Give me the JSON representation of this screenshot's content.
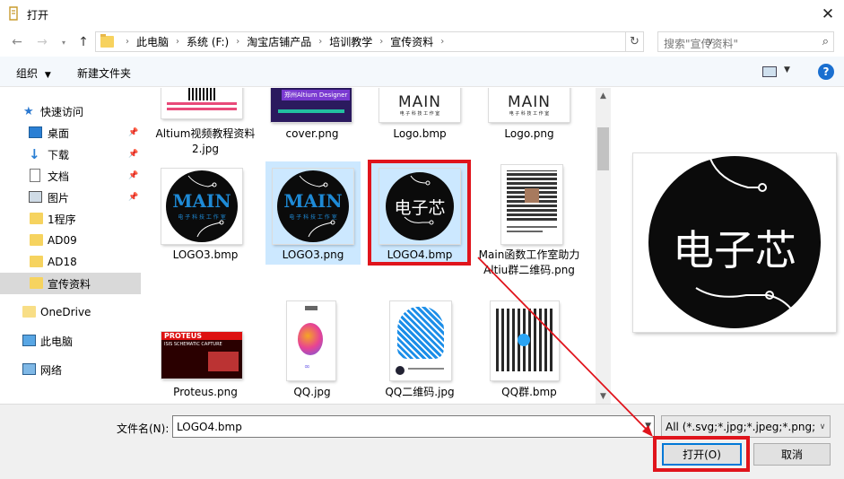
{
  "window": {
    "title": "打开"
  },
  "nav": {
    "breadcrumbs": [
      "此电脑",
      "系统 (F:)",
      "淘宝店铺产品",
      "培训教学",
      "宣传资料"
    ],
    "search_placeholder": "搜索\"宣传资料\""
  },
  "toolbar": {
    "organize": "组织",
    "new_folder": "新建文件夹"
  },
  "sidebar": {
    "items": [
      {
        "label": "快速访问",
        "icon": "star-icon"
      },
      {
        "label": "桌面",
        "icon": "desktop-icon",
        "pinned": true
      },
      {
        "label": "下载",
        "icon": "download-icon",
        "pinned": true
      },
      {
        "label": "文档",
        "icon": "document-icon",
        "pinned": true
      },
      {
        "label": "图片",
        "icon": "picture-icon",
        "pinned": true
      },
      {
        "label": "1程序",
        "icon": "folder-icon"
      },
      {
        "label": "AD09",
        "icon": "folder-icon"
      },
      {
        "label": "AD18",
        "icon": "folder-icon"
      },
      {
        "label": "宣传资料",
        "icon": "folder-icon",
        "selected": true
      },
      {
        "label": "OneDrive",
        "icon": "cloud-folder-icon"
      },
      {
        "label": "此电脑",
        "icon": "computer-icon"
      },
      {
        "label": "网络",
        "icon": "network-icon"
      }
    ]
  },
  "files": [
    {
      "name": "Altium视频教程资料2.jpg"
    },
    {
      "name": "cover.png",
      "thumb_text": "郑州Altium Designer"
    },
    {
      "name": "Logo.bmp",
      "thumb_text": "MAIN",
      "thumb_sub": "电 子 科 技 工 作 室"
    },
    {
      "name": "Logo.png",
      "thumb_text": "MAIN",
      "thumb_sub": "电 子 科 技 工 作 室"
    },
    {
      "name": "LOGO3.bmp",
      "thumb_text": "MAIN",
      "thumb_sub": "电 子 科 技 工 作 室"
    },
    {
      "name": "LOGO3.png",
      "thumb_text": "MAIN",
      "thumb_sub": "电 子 科 技 工 作 室"
    },
    {
      "name": "LOGO4.bmp",
      "thumb_text": "电子芯",
      "selected": true
    },
    {
      "name": "Main函数工作室助力Altiu群二维码.png"
    },
    {
      "name": "Proteus.png",
      "thumb_text": "PROTEUS",
      "thumb_sub": "ISIS SCHEMATIC CAPTURE"
    },
    {
      "name": "QQ.jpg"
    },
    {
      "name": "QQ二维码.jpg"
    },
    {
      "name": "QQ群.bmp"
    }
  ],
  "preview": {
    "text": "电子芯"
  },
  "bottom": {
    "filename_label": "文件名(N):",
    "filename_value": "LOGO4.bmp",
    "filter": "All (*.svg;*.jpg;*.jpeg;*.png;*.i",
    "open": "打开(O)",
    "cancel": "取消"
  },
  "colors": {
    "highlight": "#e0141c",
    "selection": "#cce8ff",
    "accent": "#0078d7",
    "logo_blue": "#1e8ad6"
  }
}
